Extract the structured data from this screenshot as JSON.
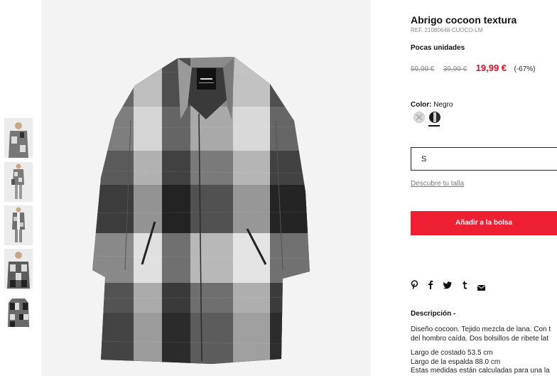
{
  "gallery": {
    "thumbnails": [
      {
        "label": "Vista frontal con modelo"
      },
      {
        "label": "Vista completa con modelo"
      },
      {
        "label": "Modelo con abrigo abierto"
      },
      {
        "label": "Detalle del abrigo"
      },
      {
        "label": "Prenda sola"
      }
    ],
    "main_image_alt": "Abrigo cocoon textura"
  },
  "product": {
    "title": "Abrigo cocoon textura",
    "ref": "REF. 21080648-CUOCO-LM",
    "stock": "Pocas unidades",
    "price_original": "59,99 €",
    "price_previous": "39,99 €",
    "price_current": "19,99 €",
    "discount": "(-67%)",
    "color_label": "Color:",
    "color_value": "Negro",
    "size_selected": "S",
    "size_guide_link": "Descubre tu talla",
    "add_to_bag": "Añadir a la bolsa",
    "description_title": "Descripción -",
    "description_lines": [
      "Diseño cocoon. Tejido mezcla de lana. Con t",
      "del hombro caída. Dos bolsillos de ribete lat"
    ],
    "measurement_lines": [
      "Largo de costado 53.5 cm",
      "Largo de la espalda 88.0 cm",
      "Estas medidas están calculadas para una la"
    ]
  },
  "social": [
    "pinterest-icon",
    "facebook-icon",
    "twitter-icon",
    "tumblr-icon",
    "email-icon"
  ],
  "colors": {
    "sale_red": "#e30d24",
    "button_red": "#ee1f33",
    "text": "#111111",
    "muted": "#888888"
  }
}
